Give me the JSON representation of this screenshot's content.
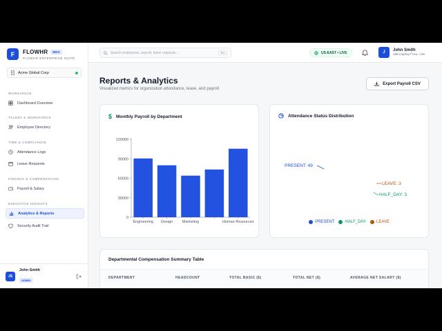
{
  "brand": {
    "name": "FLOWHR",
    "badge": "MNC",
    "subtitle": "FLOWHR ENTERPRISE SUITE",
    "logo_letter": "F"
  },
  "org": {
    "name": "Acme Global Corp",
    "status_color": "#22c55e"
  },
  "sidebar": {
    "sections": [
      {
        "label": "WORKSPACE",
        "items": [
          {
            "label": "Dashboard Overview",
            "icon": "layout-icon"
          }
        ]
      },
      {
        "label": "TALENT & WORKFORCE",
        "items": [
          {
            "label": "Employee Directory",
            "icon": "users-icon"
          }
        ]
      },
      {
        "label": "TIME & COMPLIANCE",
        "items": [
          {
            "label": "Attendance Logs",
            "icon": "clock-icon"
          },
          {
            "label": "Leave Requests",
            "icon": "calendar-icon"
          }
        ]
      },
      {
        "label": "FINANCE & COMPENSATION",
        "items": [
          {
            "label": "Payroll & Salary",
            "icon": "wallet-icon"
          }
        ]
      },
      {
        "label": "EXECUTIVE INSIGHTS",
        "items": [
          {
            "label": "Analytics & Reports",
            "icon": "bar-chart-icon",
            "active": true
          },
          {
            "label": "Security Audit Trail",
            "icon": "shield-icon"
          }
        ]
      }
    ],
    "user": {
      "initials": "JS",
      "name": "John Smith",
      "role": "ADMIN"
    }
  },
  "topbar": {
    "search_placeholder": "Search employees, payroll, leave requests...",
    "shortcut": "⌘K",
    "region": "US-EAST • LIVE",
    "user": {
      "initial": "J",
      "name": "John Smith",
      "email": "admin@dayflow.com"
    }
  },
  "page": {
    "title": "Reports & Analytics",
    "subtitle": "Visualized metrics for organization attendance, leave, and payroll",
    "export_label": "Export Payroll CSV"
  },
  "payroll_chart": {
    "title": "Monthly Payroll by Department",
    "chart_data": {
      "type": "bar",
      "categories": [
        "Engineering",
        "Design",
        "Marketing",
        "",
        "Human Resources"
      ],
      "values": [
        90500,
        80000,
        64000,
        73500,
        105500
      ],
      "ylim": [
        0,
        120000
      ],
      "yticks": [
        0,
        30000,
        60000,
        90000,
        120000
      ],
      "color": "#2352e0",
      "grid": false
    }
  },
  "status_chart": {
    "title": "Attendance Status Distribution",
    "chart_data": {
      "type": "pie",
      "labels": [
        "PRESENT",
        "HALF_DAY",
        "LEAVE"
      ],
      "values": [
        49,
        3,
        3
      ],
      "data_labels": [
        "PRESENT: 49",
        "HALF_DAY: 3",
        "LEAVE: 3"
      ],
      "colors": [
        "#1d4ed8",
        "#059669",
        "#b45309"
      ],
      "legend_position": "bottom"
    }
  },
  "table": {
    "title": "Departmental Compensation Summary Table",
    "columns": [
      "DEPARTMENT",
      "HEADCOUNT",
      "TOTAL BASIC ($)",
      "TOTAL NET ($)",
      "AVERAGE NET SALARY ($)"
    ]
  }
}
